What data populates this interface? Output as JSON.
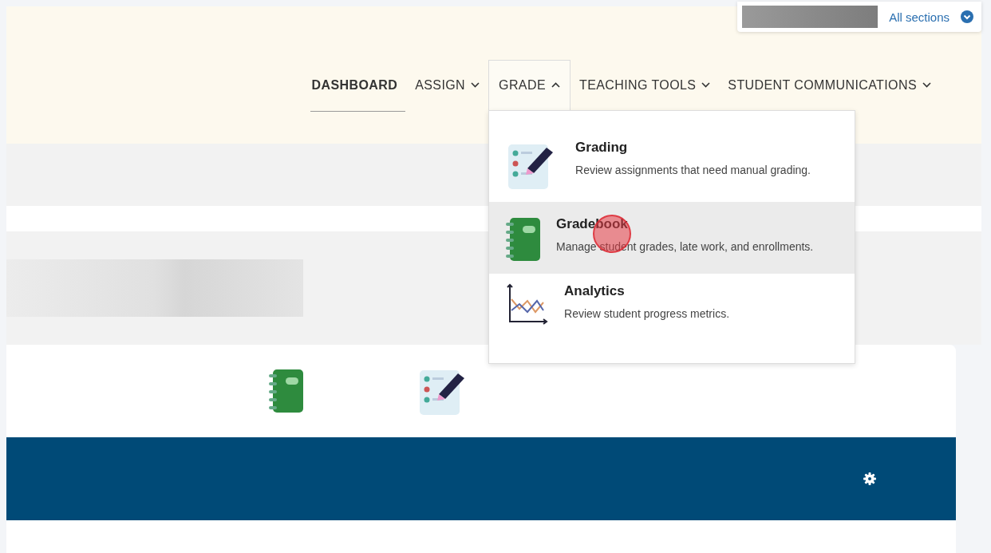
{
  "section_selector": {
    "label": "All sections"
  },
  "nav": [
    {
      "label": "DASHBOARD",
      "selected": true,
      "has_menu": false,
      "expanded": false
    },
    {
      "label": "ASSIGN",
      "selected": false,
      "has_menu": true,
      "expanded": false
    },
    {
      "label": "GRADE",
      "selected": false,
      "has_menu": true,
      "expanded": true
    },
    {
      "label": "TEACHING TOOLS",
      "selected": false,
      "has_menu": true,
      "expanded": false
    },
    {
      "label": "STUDENT COMMUNICATIONS",
      "selected": false,
      "has_menu": true,
      "expanded": false
    }
  ],
  "grade_menu": [
    {
      "kind": "grading",
      "title": "Grading",
      "description": "Review assignments that need manual grading.",
      "selected": false
    },
    {
      "kind": "gradebook",
      "title": "Gradebook",
      "description": "Manage student grades, late work, and enrollments.",
      "selected": true
    },
    {
      "kind": "analytics",
      "title": "Analytics",
      "description": "Review student progress metrics.",
      "selected": false
    }
  ],
  "card_icons": [
    {
      "kind": "gradebook"
    },
    {
      "kind": "grading"
    }
  ]
}
